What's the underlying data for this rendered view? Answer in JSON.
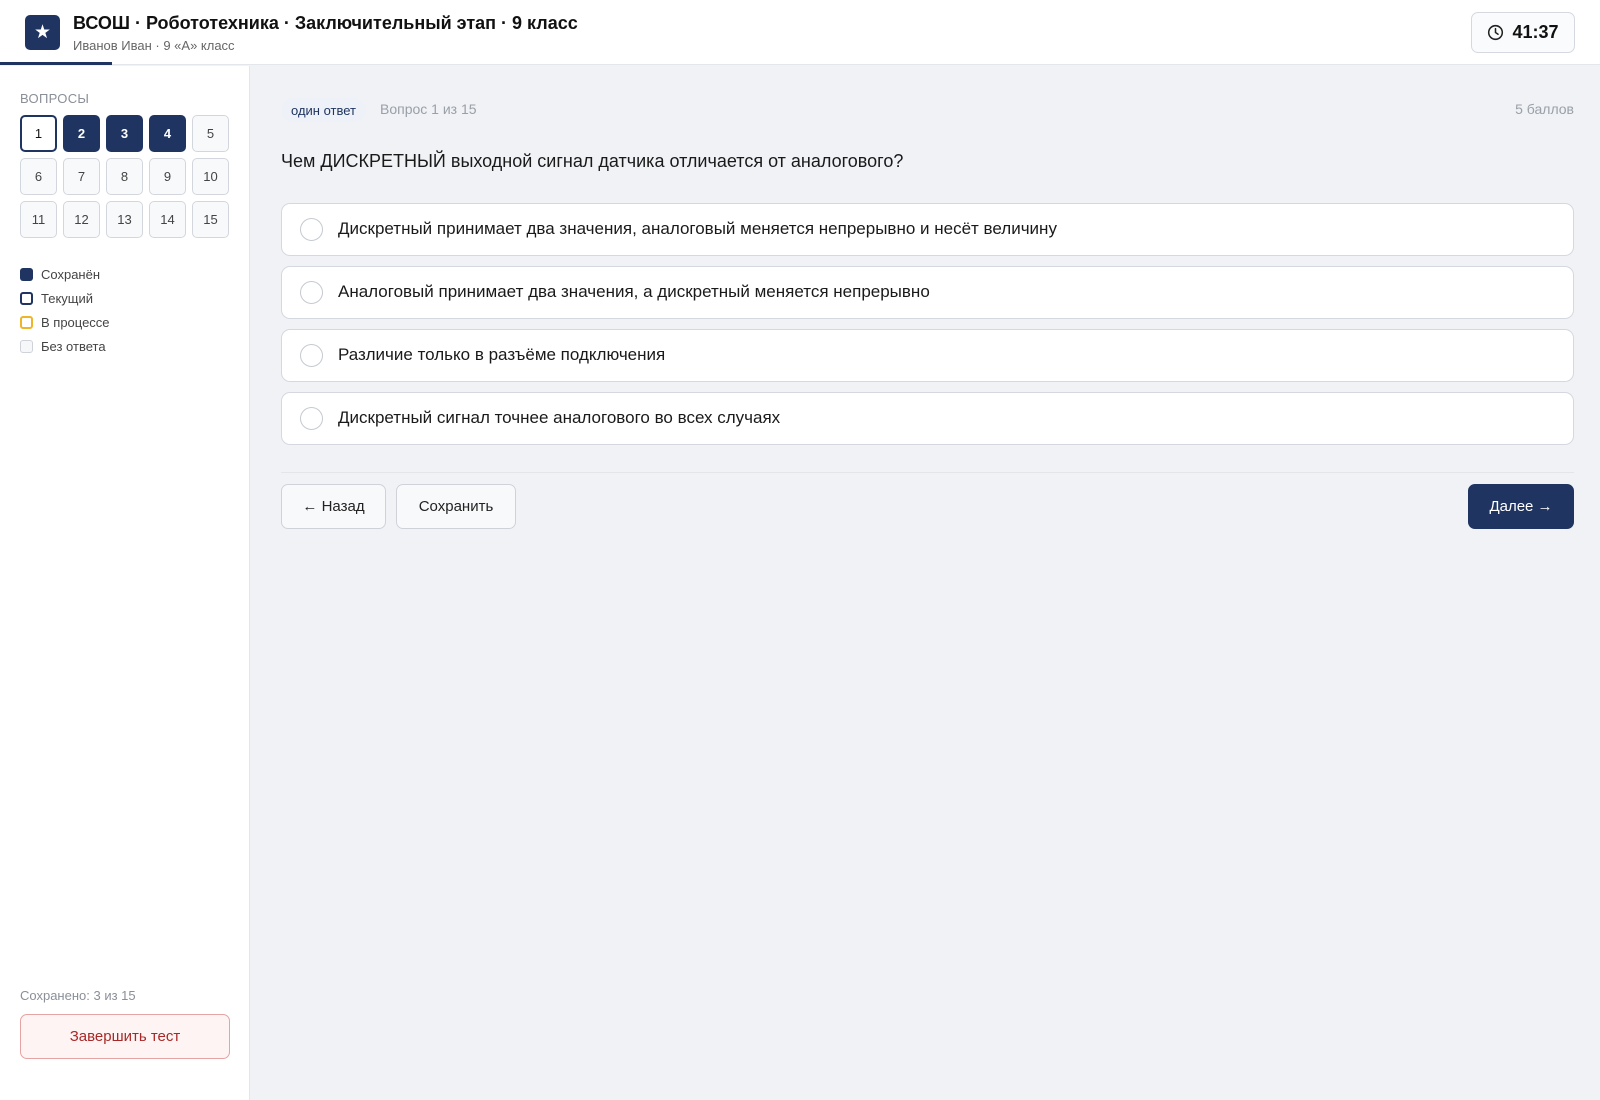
{
  "header": {
    "logo_glyph": "★",
    "title": "ВСОШ · Робототехника · Заключительный этап · 9 класс",
    "subtitle": "Иванов Иван · 9 «А» класс",
    "timer": "41:37"
  },
  "sidebar": {
    "heading": "ВОПРОСЫ",
    "questions": [
      {
        "n": "1",
        "state": "current"
      },
      {
        "n": "2",
        "state": "saved"
      },
      {
        "n": "3",
        "state": "saved"
      },
      {
        "n": "4",
        "state": "saved"
      },
      {
        "n": "5",
        "state": "none"
      },
      {
        "n": "6",
        "state": "none"
      },
      {
        "n": "7",
        "state": "none"
      },
      {
        "n": "8",
        "state": "none"
      },
      {
        "n": "9",
        "state": "none"
      },
      {
        "n": "10",
        "state": "none"
      },
      {
        "n": "11",
        "state": "none"
      },
      {
        "n": "12",
        "state": "none"
      },
      {
        "n": "13",
        "state": "none"
      },
      {
        "n": "14",
        "state": "none"
      },
      {
        "n": "15",
        "state": "none"
      }
    ],
    "legend": {
      "saved": "Сохранён",
      "current": "Текущий",
      "in_progress": "В процессе",
      "no_answer": "Без ответа"
    },
    "saved_count": "Сохранено: 3 из 15",
    "finish_label": "Завершить тест"
  },
  "main": {
    "badge": "один ответ",
    "question_number": "Вопрос 1 из 15",
    "points": "5 баллов",
    "question": "Чем ДИСКРЕТНЫЙ выходной сигнал датчика отличается от аналогового?",
    "options": [
      "Дискретный принимает два значения, аналоговый меняется непрерывно и несёт величину",
      "Аналоговый принимает два значения, а дискретный меняется непрерывно",
      "Различие только в разъёме подключения",
      "Дискретный сигнал точнее аналогового во всех случаях"
    ],
    "back_label": "← Назад",
    "save_label": "Сохранить",
    "next_label": "Далее →"
  },
  "colors": {
    "accent": "#1f3461",
    "in_progress": "#f0b429",
    "danger": "#a82828"
  }
}
